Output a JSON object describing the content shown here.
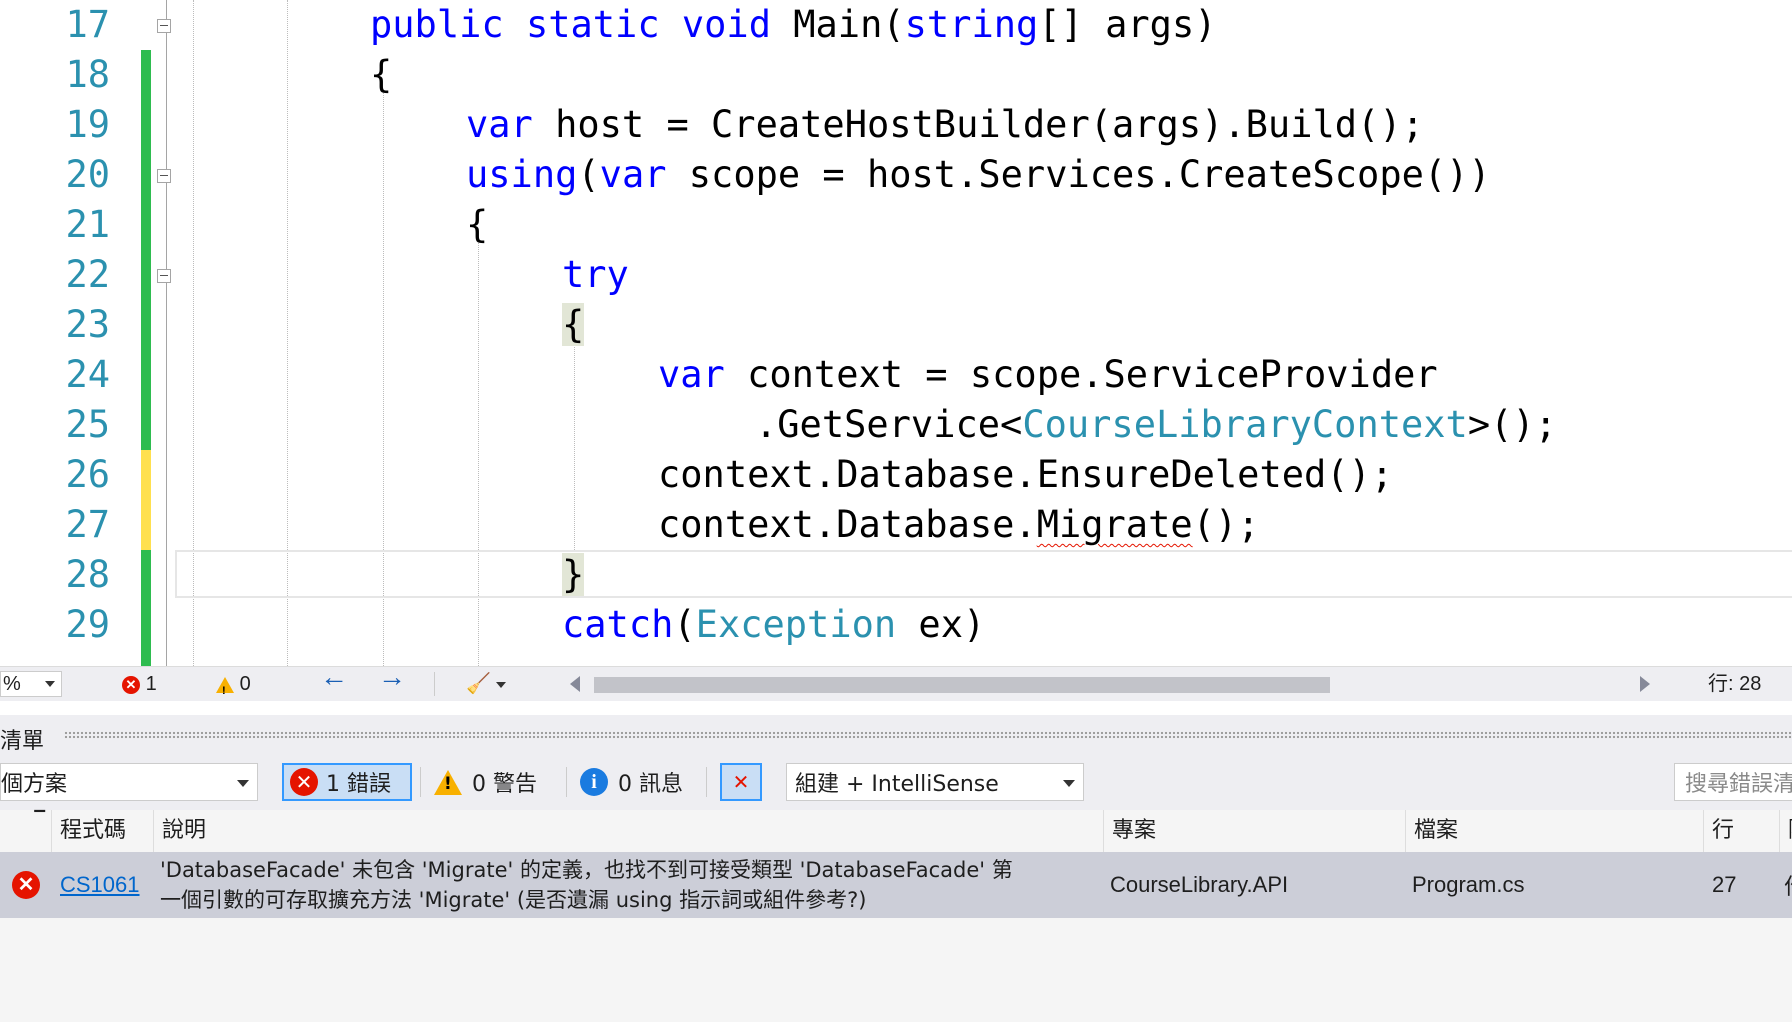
{
  "editor": {
    "lines": [
      {
        "num": "17"
      },
      {
        "num": "18"
      },
      {
        "num": "19"
      },
      {
        "num": "20"
      },
      {
        "num": "21"
      },
      {
        "num": "22"
      },
      {
        "num": "23"
      },
      {
        "num": "24"
      },
      {
        "num": "25"
      },
      {
        "num": "26"
      },
      {
        "num": "27"
      },
      {
        "num": "28"
      },
      {
        "num": "29"
      }
    ],
    "code": {
      "l17_kw1": "public",
      "l17_kw2": "static",
      "l17_kw3": "void",
      "l17_rest1": " Main(",
      "l17_kw4": "string",
      "l17_rest2": "[] args)",
      "l18": "{",
      "l19_kw": "var",
      "l19_rest": " host = CreateHostBuilder(args).Build();",
      "l20_kw1": "using",
      "l20_p": "(",
      "l20_kw2": "var",
      "l20_rest": " scope = host.Services.CreateScope())",
      "l21": "{",
      "l22_kw": "try",
      "l23": "{",
      "l24_kw": "var",
      "l24_rest": " context = scope.ServiceProvider",
      "l25_a": ".GetService<",
      "l25_type": "CourseLibraryContext",
      "l25_b": ">();",
      "l26": "context.Database.EnsureDeleted();",
      "l27_a": "context.Database.",
      "l27_err": "Migrate",
      "l27_b": "();",
      "l28": "}",
      "l29_kw": "catch",
      "l29_p": "(",
      "l29_type": "Exception",
      "l29_rest": " ex)"
    }
  },
  "status_bar": {
    "zoom": "%",
    "errors": "1",
    "warnings": "0",
    "line_label": "行: 28"
  },
  "error_panel": {
    "title": "清單",
    "scope_dropdown": "個方案",
    "errors_toggle": "1 錯誤",
    "warnings_toggle": "0 警告",
    "messages_toggle": "0 訊息",
    "build_dropdown": "組建 + IntelliSense",
    "search_placeholder": "搜尋錯誤清",
    "headers": {
      "code": "程式碼",
      "description": "說明",
      "project": "專案",
      "file": "檔案",
      "line": "行",
      "suppression": "隱"
    },
    "rows": [
      {
        "code": "CS1061",
        "desc_line1": "'DatabaseFacade' 未包含 'Migrate' 的定義，也找不到可接受類型 'DatabaseFacade' 第",
        "desc_line2": "一個引數的可存取擴充方法 'Migrate' (是否遺漏 using 指示詞或組件參考?)",
        "project": "CourseLibrary.API",
        "file": "Program.cs",
        "line": "27",
        "suppression": "作"
      }
    ]
  },
  "colors": {
    "keyword": "#0000ff",
    "type": "#2b91af",
    "line_number": "#2b91af",
    "change_saved": "#2ebc4f",
    "change_unsaved": "#ffe04e",
    "error": "#e51400"
  }
}
